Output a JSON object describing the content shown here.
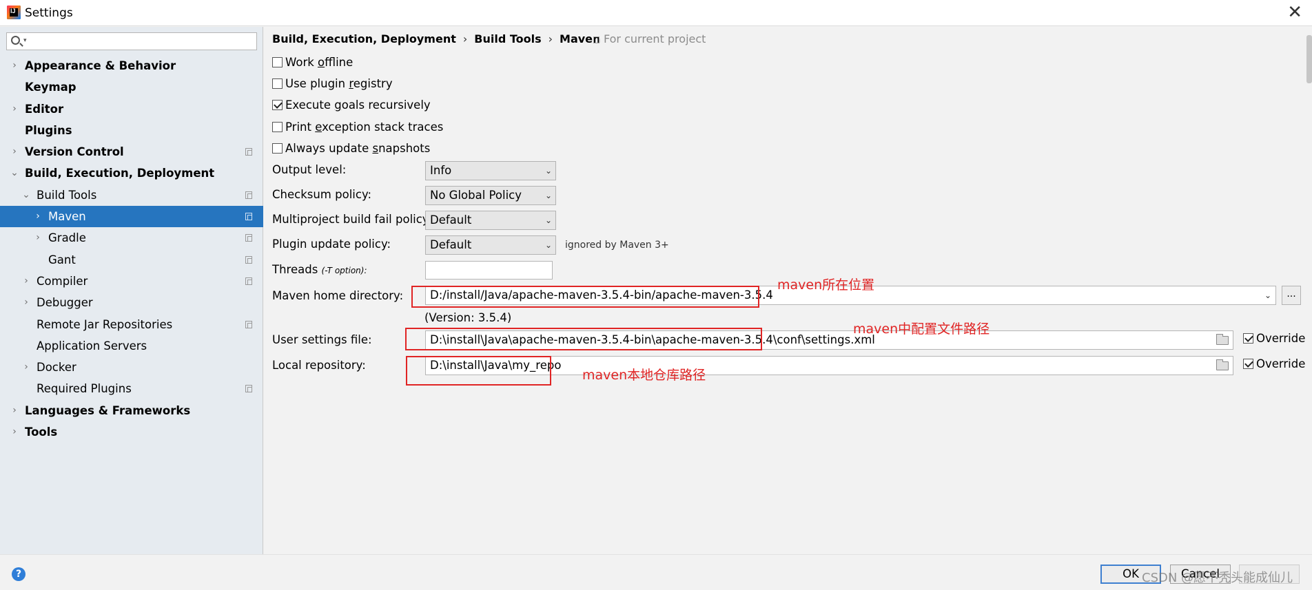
{
  "window": {
    "title": "Settings",
    "close": "✕",
    "logo_text": "IJ"
  },
  "search": {
    "placeholder": ""
  },
  "sidebar": {
    "items": [
      {
        "label": "Appearance & Behavior",
        "bold": true,
        "chev": "›",
        "indent": 0,
        "copy": false
      },
      {
        "label": "Keymap",
        "bold": true,
        "chev": "",
        "indent": 0,
        "copy": false
      },
      {
        "label": "Editor",
        "bold": true,
        "chev": "›",
        "indent": 0,
        "copy": false
      },
      {
        "label": "Plugins",
        "bold": true,
        "chev": "",
        "indent": 0,
        "copy": false
      },
      {
        "label": "Version Control",
        "bold": true,
        "chev": "›",
        "indent": 0,
        "copy": true
      },
      {
        "label": "Build, Execution, Deployment",
        "bold": true,
        "chev": "⌄",
        "indent": 0,
        "copy": false
      },
      {
        "label": "Build Tools",
        "bold": false,
        "chev": "⌄",
        "indent": 1,
        "copy": true
      },
      {
        "label": "Maven",
        "bold": false,
        "chev": "›",
        "indent": 2,
        "copy": true,
        "selected": true
      },
      {
        "label": "Gradle",
        "bold": false,
        "chev": "›",
        "indent": 2,
        "copy": true
      },
      {
        "label": "Gant",
        "bold": false,
        "chev": "",
        "indent": 2,
        "copy": true
      },
      {
        "label": "Compiler",
        "bold": false,
        "chev": "›",
        "indent": 1,
        "copy": true
      },
      {
        "label": "Debugger",
        "bold": false,
        "chev": "›",
        "indent": 1,
        "copy": false
      },
      {
        "label": "Remote Jar Repositories",
        "bold": false,
        "chev": "",
        "indent": 1,
        "copy": true
      },
      {
        "label": "Application Servers",
        "bold": false,
        "chev": "",
        "indent": 1,
        "copy": false
      },
      {
        "label": "Docker",
        "bold": false,
        "chev": "›",
        "indent": 1,
        "copy": false
      },
      {
        "label": "Required Plugins",
        "bold": false,
        "chev": "",
        "indent": 1,
        "copy": true
      },
      {
        "label": "Languages & Frameworks",
        "bold": true,
        "chev": "›",
        "indent": 0,
        "copy": false
      },
      {
        "label": "Tools",
        "bold": true,
        "chev": "›",
        "indent": 0,
        "copy": false
      }
    ]
  },
  "breadcrumb": {
    "part1": "Build, Execution, Deployment",
    "sep": "›",
    "part2": "Build Tools",
    "part3": "Maven",
    "scope": "For current project"
  },
  "options": {
    "work_offline_pre": "Work ",
    "work_offline_u": "o",
    "work_offline_post": "ffline",
    "plugin_registry_pre": "Use plugin ",
    "plugin_registry_u": "r",
    "plugin_registry_post": "egistry",
    "execute_goals_pre": "Execute ",
    "execute_goals_u": "g",
    "execute_goals_post": "oals recursively",
    "print_exception_pre": "Print ",
    "print_exception_u": "e",
    "print_exception_post": "xception stack traces",
    "always_update_pre": "Always update ",
    "always_update_u": "s",
    "always_update_post": "napshots"
  },
  "fields": {
    "output_level_label": "Output level:",
    "output_level_value": "Info",
    "checksum_label": "Checksum policy:",
    "checksum_value": "No Global Policy",
    "multiproject_label": "Multiproject build fail policy:",
    "multiproject_value": "Default",
    "plugin_update_label": "Plugin update policy:",
    "plugin_update_value": "Default",
    "plugin_update_hint": "ignored by Maven 3+",
    "threads_label": "Threads",
    "threads_hint": "(-T option):",
    "threads_value": "",
    "maven_home_label": "Maven home directory:",
    "maven_home_value": "D:/install/Java/apache-maven-3.5.4-bin/apache-maven-3.5.4",
    "maven_version": "(Version: 3.5.4)",
    "browse": "...",
    "user_settings_label": "User settings file:",
    "user_settings_value": "D:\\install\\Java\\apache-maven-3.5.4-bin\\apache-maven-3.5.4\\conf\\settings.xml",
    "local_repo_label": "Local repository:",
    "local_repo_value": "D:\\install\\Java\\my_repo",
    "override": "Override"
  },
  "annotations": {
    "maven_home": "maven所在位置",
    "user_settings": "maven中配置文件路径",
    "local_repo": "maven本地仓库路径"
  },
  "footer": {
    "help": "?",
    "ok": "OK",
    "cancel": "Cancel",
    "apply": "",
    "watermark": "CSDN @愿不秃头能成仙儿"
  },
  "icons": {
    "select_arrow": "⌄",
    "tree_expand": "›"
  }
}
